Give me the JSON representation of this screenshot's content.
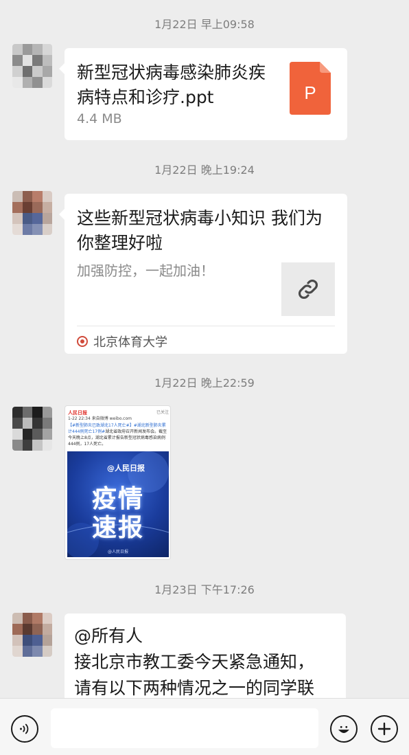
{
  "messages": {
    "m1": {
      "timestamp": "1月22日 早上09:58",
      "file_name": "新型冠状病毒感染肺炎疾病特点和诊疗.ppt",
      "file_size": "4.4 MB",
      "file_type_letter": "P"
    },
    "m2": {
      "timestamp": "1月22日 晚上19:24",
      "title": "这些新型冠状病毒小知识 我们为你整理好啦",
      "description": "加强防控，一起加油！",
      "source": "北京体育大学"
    },
    "m3": {
      "timestamp": "1月22日 晚上22:59",
      "image": {
        "account_name": "人民日报",
        "meta": "1-22 22:34  来自微博 weibo.com",
        "action": "已关注",
        "hashtag1": "【#新型肺炎已致湖北17人死亡#】",
        "hashtag2": "#湖北新型肺炎累计444例死亡17例#",
        "body": "湖北省政府召开新闻发布会。截至今天晚上8点，湖北省累计报告新型冠状病毒感染病例444例，17人死亡。",
        "poster_brand": "@人民日报",
        "poster_line1": "疫情",
        "poster_line2": "速报",
        "poster_footer": "@人民日报"
      }
    },
    "m4": {
      "timestamp": "1月23日 下午17:26",
      "text": "@所有人\n接北京市教工委今天紧急通知，\n请有以下两种情况之一的同学联"
    }
  },
  "colors": {
    "background": "#ededed",
    "bubble": "#ffffff",
    "ppt_icon": "#f0633b",
    "timestamp": "#7d7d7d"
  },
  "icons": {
    "voice": "voice-icon",
    "emoji": "emoji-icon",
    "plus": "plus-icon",
    "link": "link-icon",
    "ppt": "ppt-file-icon"
  }
}
